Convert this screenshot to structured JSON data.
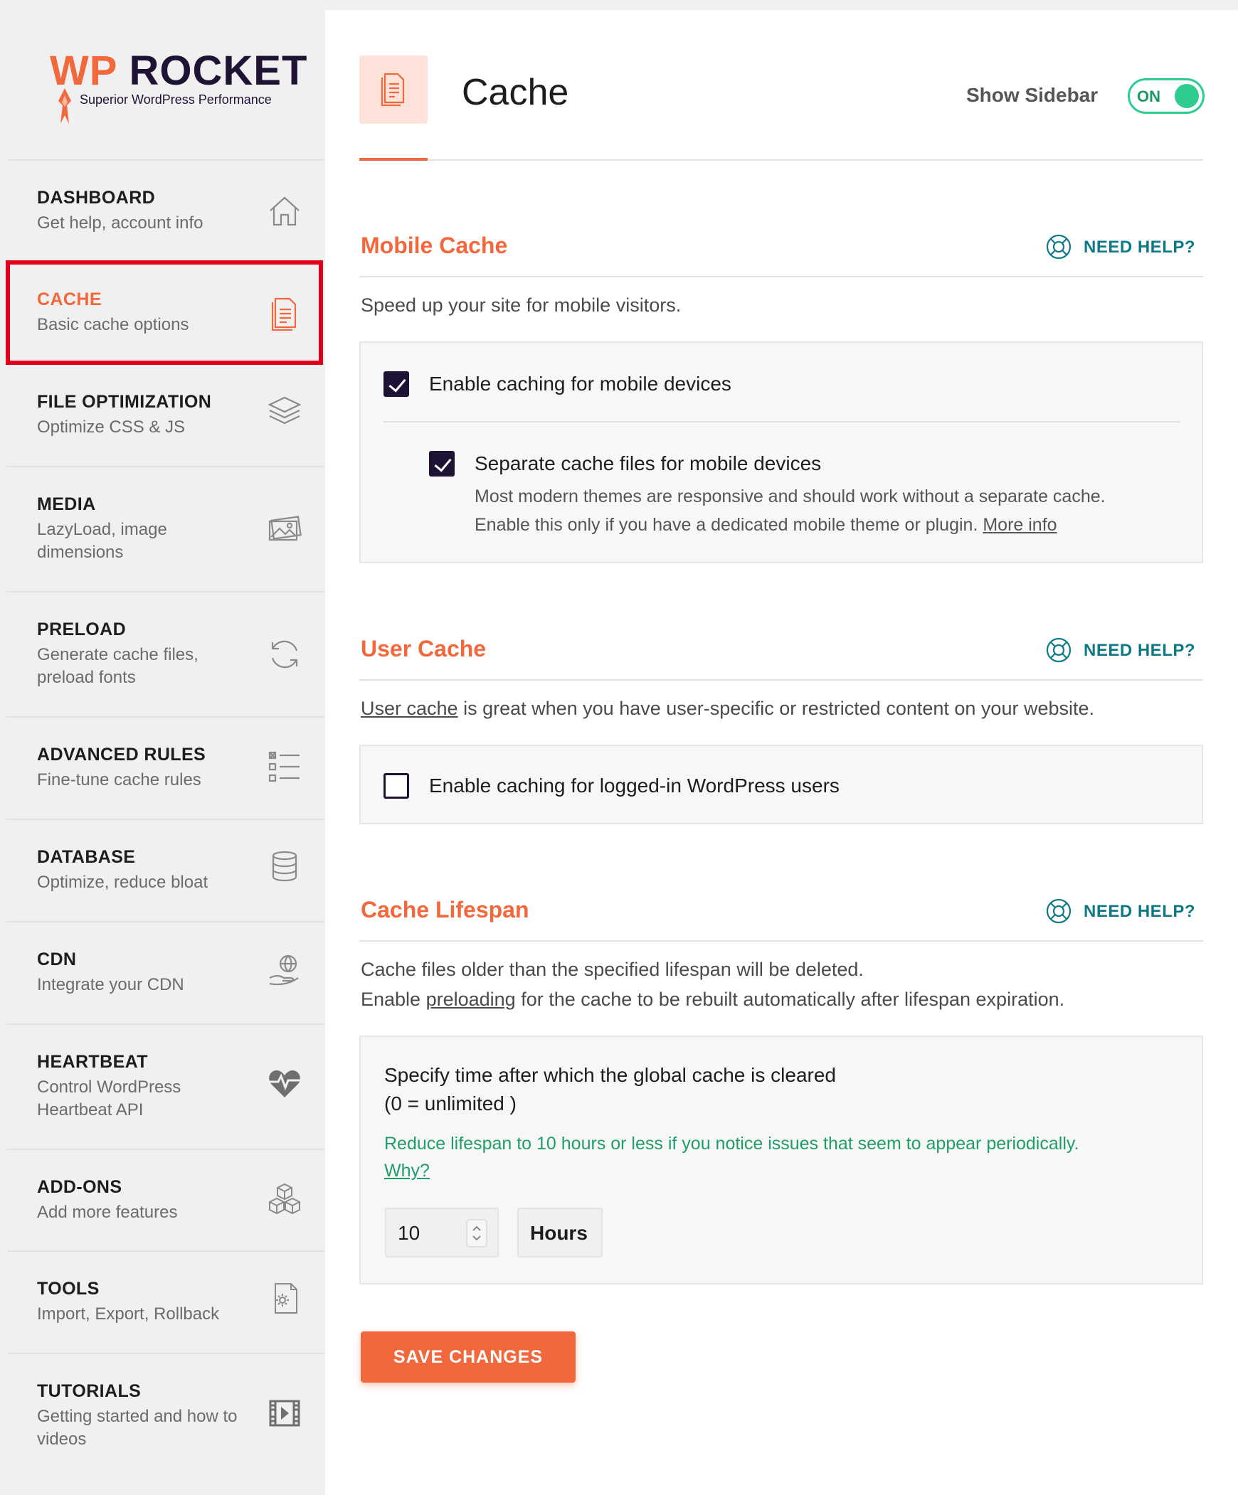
{
  "brand": {
    "logo_prefix": "WP",
    "logo_name": "ROCKET",
    "tagline": "Superior WordPress Performance"
  },
  "sidebar": {
    "items": [
      {
        "title": "DASHBOARD",
        "desc": "Get help, account info",
        "icon": "home-icon"
      },
      {
        "title": "CACHE",
        "desc": "Basic cache options",
        "icon": "document-icon",
        "active": true
      },
      {
        "title": "FILE OPTIMIZATION",
        "desc": "Optimize CSS & JS",
        "icon": "layers-icon"
      },
      {
        "title": "MEDIA",
        "desc": "LazyLoad, image dimensions",
        "icon": "image-icon"
      },
      {
        "title": "PRELOAD",
        "desc": "Generate cache files, preload fonts",
        "icon": "refresh-icon"
      },
      {
        "title": "ADVANCED RULES",
        "desc": "Fine-tune cache rules",
        "icon": "list-icon"
      },
      {
        "title": "DATABASE",
        "desc": "Optimize, reduce bloat",
        "icon": "database-icon"
      },
      {
        "title": "CDN",
        "desc": "Integrate your CDN",
        "icon": "globe-hand-icon"
      },
      {
        "title": "HEARTBEAT",
        "desc": "Control WordPress Heartbeat API",
        "icon": "heartbeat-icon"
      },
      {
        "title": "ADD-ONS",
        "desc": "Add more features",
        "icon": "cubes-icon"
      },
      {
        "title": "TOOLS",
        "desc": "Import, Export, Rollback",
        "icon": "gear-file-icon"
      },
      {
        "title": "TUTORIALS",
        "desc": "Getting started and how to videos",
        "icon": "video-icon"
      }
    ]
  },
  "header": {
    "title": "Cache",
    "show_sidebar_label": "Show Sidebar",
    "toggle_label": "ON"
  },
  "need_help_label": "NEED HELP?",
  "mobile_cache": {
    "title": "Mobile Cache",
    "description": "Speed up your site for mobile visitors.",
    "enable_label": "Enable caching for mobile devices",
    "enable_checked": true,
    "separate_label": "Separate cache files for mobile devices",
    "separate_checked": true,
    "separate_desc_line1": "Most modern themes are responsive and should work without a separate cache.",
    "separate_desc_line2": "Enable this only if you have a dedicated mobile theme or plugin.",
    "more_info_link": "More info"
  },
  "user_cache": {
    "title": "User Cache",
    "desc_link": "User cache",
    "desc_rest": " is great when you have user-specific or restricted content on your website.",
    "enable_label": "Enable caching for logged-in WordPress users",
    "enable_checked": false
  },
  "cache_lifespan": {
    "title": "Cache Lifespan",
    "desc_line1": "Cache files older than the specified lifespan will be deleted.",
    "desc_line2_pre": "Enable ",
    "desc_line2_link": "preloading",
    "desc_line2_post": " for the cache to be rebuilt automatically after lifespan expiration.",
    "spec_line1": "Specify time after which the global cache is cleared",
    "spec_line2": "(0 = unlimited )",
    "warning": "Reduce lifespan to 10 hours or less if you notice issues that seem to appear periodically.",
    "why_link": "Why?",
    "value": "10",
    "unit": "Hours"
  },
  "save_button": "SAVE CHANGES",
  "colors": {
    "accent": "#f2683d",
    "teal": "#0f7a87",
    "green": "#1f9e6a",
    "dark": "#1f1335",
    "active_frame": "#e0001a"
  }
}
